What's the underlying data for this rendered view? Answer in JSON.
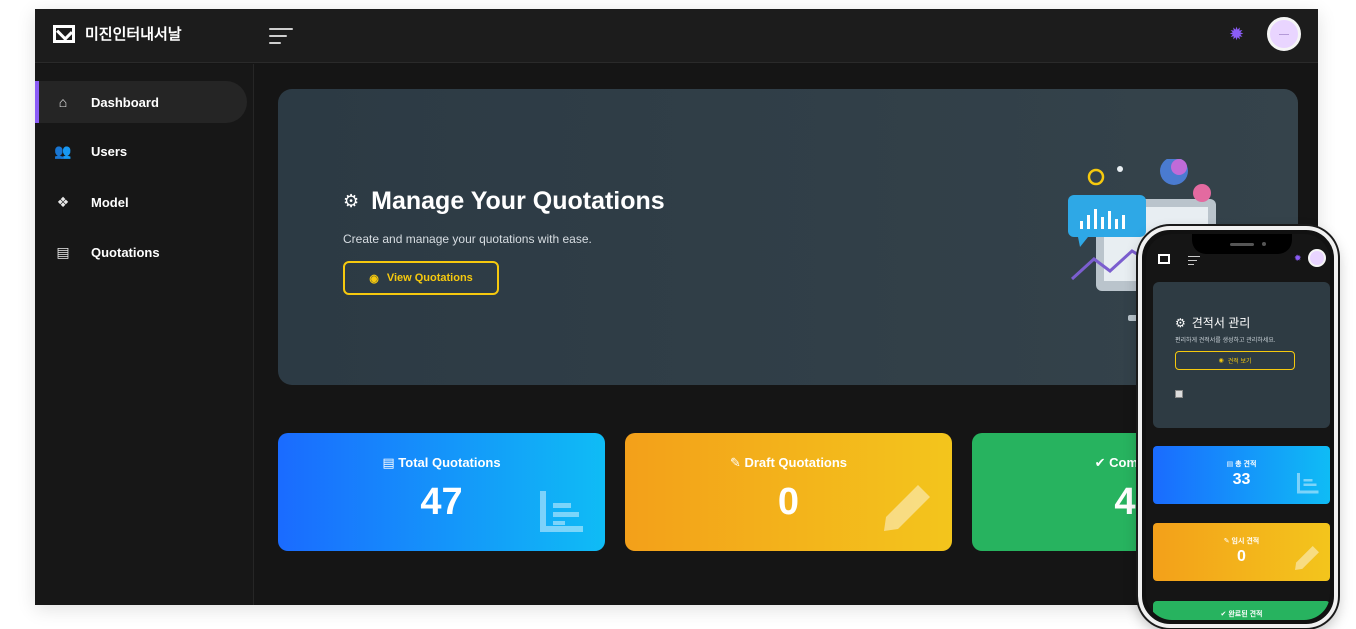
{
  "app": {
    "brand": "미진인터내서날"
  },
  "sidebar": {
    "items": [
      {
        "label": "Dashboard",
        "icon": "home-icon",
        "active": true
      },
      {
        "label": "Users",
        "icon": "users-icon",
        "active": false
      },
      {
        "label": "Model",
        "icon": "cubes-icon",
        "active": false
      },
      {
        "label": "Quotations",
        "icon": "document-icon",
        "active": false
      }
    ]
  },
  "hero": {
    "title": "Manage Your Quotations",
    "subtitle": "Create and manage your quotations with ease.",
    "button_label": "View Quotations"
  },
  "cards": [
    {
      "title": "Total Quotations",
      "value": "47",
      "icon": "file-icon",
      "color": "#1a6bff"
    },
    {
      "title": "Draft Quotations",
      "value": "0",
      "icon": "pencil-icon",
      "color": "#f3a01a"
    },
    {
      "title": "Completed",
      "value": "47",
      "icon": "check-circle-icon",
      "color": "#27b35f"
    }
  ],
  "mobile": {
    "hero_title": "견적서 관리",
    "hero_subtitle": "편리하게 견적서를 생성하고 관리하세요.",
    "hero_button": "견적 보기",
    "cards": [
      {
        "title": "총 견적",
        "value": "33"
      },
      {
        "title": "임시 견적",
        "value": "0"
      },
      {
        "title": "완료된 견적",
        "value": ""
      }
    ]
  },
  "colors": {
    "accent": "#8b5cf6",
    "highlight": "#f6c90e",
    "background": "#151515"
  }
}
